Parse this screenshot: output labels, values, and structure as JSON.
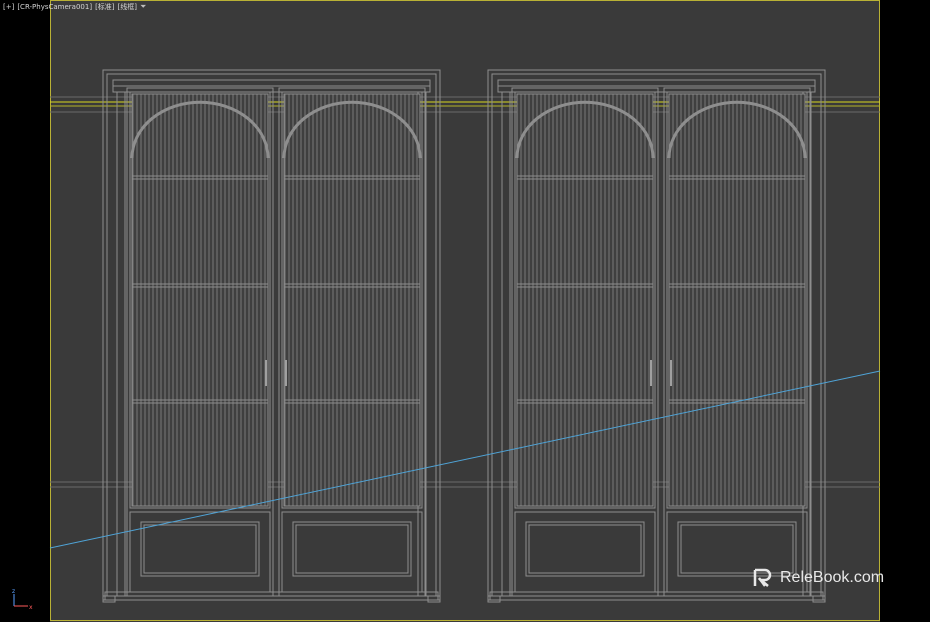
{
  "viewport": {
    "label_parts": [
      "[+]",
      "[CR-PhysCamera001]",
      "[标准]",
      "[线框]"
    ],
    "filter_icon": "funnel-icon"
  },
  "watermark": {
    "text": "RelеBook.com",
    "logo_icon": "relebook-logo-icon"
  },
  "axis_gizmo": {
    "labels": [
      "z",
      "x"
    ]
  },
  "colors": {
    "background": "#000000",
    "viewport_fill": "#3a3a3a",
    "wireframe": "#8e8e8e",
    "border_selected": "#b9b135",
    "guide_line": "#d8d820",
    "camera_line": "#4fa3d6"
  }
}
